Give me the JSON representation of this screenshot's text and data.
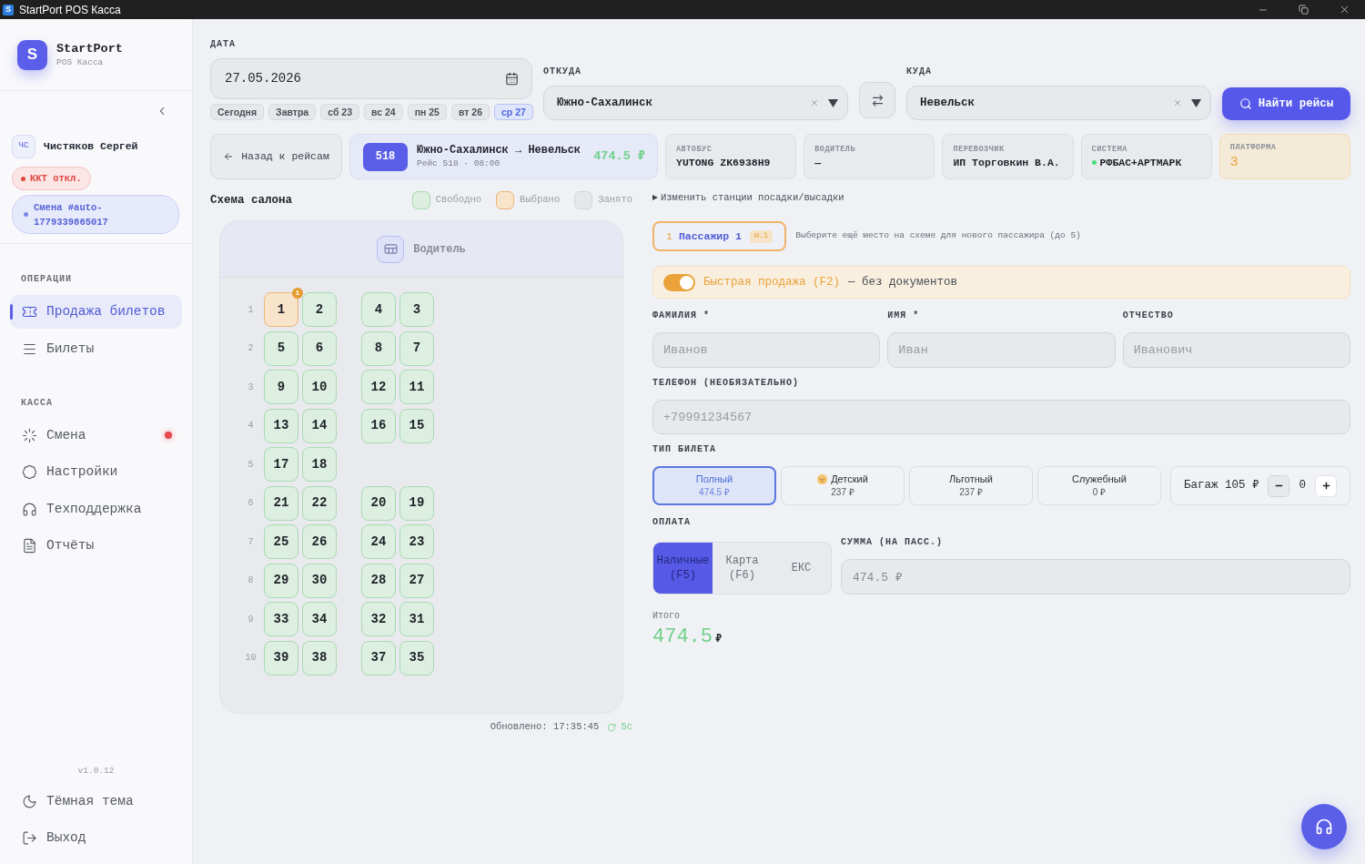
{
  "window": {
    "app_icon": "S",
    "title": "StartPort POS Касса"
  },
  "sidebar": {
    "logo_letter": "S",
    "brand_name": "StartPort",
    "brand_subtitle": "POS Касса",
    "user": {
      "initials": "ЧС",
      "name": "Чистяков Сергей"
    },
    "kkt_status": "ККТ откл.",
    "shift": "Смена #auto-1779339865017",
    "sections": [
      {
        "title": "ОПЕРАЦИИ",
        "items": [
          {
            "label": "Продажа билетов",
            "selected": true,
            "notification": false
          },
          {
            "label": "Билеты",
            "selected": false,
            "notification": false
          }
        ]
      },
      {
        "title": "КАССА",
        "items": [
          {
            "label": "Смена",
            "selected": false,
            "notification": true
          },
          {
            "label": "Настройки",
            "selected": false,
            "notification": false
          },
          {
            "label": "Техподдержка",
            "selected": false,
            "notification": false
          },
          {
            "label": "Отчёты",
            "selected": false,
            "notification": false
          }
        ]
      }
    ],
    "version": "v1.0.12",
    "footer_items": [
      "Тёмная тема",
      "Выход"
    ]
  },
  "search": {
    "date": {
      "label": "ДАТА",
      "value": "27.05.2026",
      "quick_dates": [
        {
          "label": "Сегодня",
          "selected": false
        },
        {
          "label": "Завтра",
          "selected": false
        },
        {
          "label": "сб 23",
          "selected": false
        },
        {
          "label": "вс 24",
          "selected": false
        },
        {
          "label": "пн 25",
          "selected": false
        },
        {
          "label": "вт 26",
          "selected": false
        },
        {
          "label": "ср 27",
          "selected": true
        }
      ]
    },
    "from": {
      "label": "ОТКУДА",
      "value": "Южно-Сахалинск"
    },
    "to": {
      "label": "КУДА",
      "value": "Невельск"
    },
    "search_button": "Найти рейсы"
  },
  "trip": {
    "back_button": "Назад к рейсам",
    "number": "518",
    "route": "Южно-Сахалинск → Невельск",
    "details": "Рейс 518 · 08:00",
    "price": "474.5 ₽",
    "info": [
      {
        "label": "АВТОБУС",
        "value": "YUTONG ZK6938H9",
        "kind": "plain"
      },
      {
        "label": "ВОДИТЕЛЬ",
        "value": "—",
        "kind": "plain"
      },
      {
        "label": "ПЕРЕВОЗЧИК",
        "value": "ИП Торговкин В.А.",
        "kind": "plain"
      },
      {
        "label": "СИСТЕМА",
        "value": "РФБАС+АРТМАРК",
        "kind": "status",
        "online": true
      },
      {
        "label": "ПЛАТФОРМА",
        "value": "3",
        "kind": "highlight"
      }
    ]
  },
  "seat_map": {
    "title": "Схема салона",
    "legend": [
      {
        "label": "Свободно",
        "kind": "free"
      },
      {
        "label": "Выбрано",
        "kind": "selected"
      },
      {
        "label": "Занято",
        "kind": "taken"
      }
    ],
    "driver_label": "Водитель",
    "rows": [
      {
        "number": "1",
        "left": [
          {
            "label": "1",
            "selected": true,
            "badge": "1"
          },
          {
            "label": "2",
            "selected": false
          }
        ],
        "right": [
          {
            "label": "4",
            "selected": false
          },
          {
            "label": "3",
            "selected": false
          }
        ]
      },
      {
        "number": "2",
        "left": [
          {
            "label": "5",
            "selected": false
          },
          {
            "label": "6",
            "selected": false
          }
        ],
        "right": [
          {
            "label": "8",
            "selected": false
          },
          {
            "label": "7",
            "selected": false
          }
        ]
      },
      {
        "number": "3",
        "left": [
          {
            "label": "9",
            "selected": false
          },
          {
            "label": "10",
            "selected": false
          }
        ],
        "right": [
          {
            "label": "12",
            "selected": false
          },
          {
            "label": "11",
            "selected": false
          }
        ]
      },
      {
        "number": "4",
        "left": [
          {
            "label": "13",
            "selected": false
          },
          {
            "label": "14",
            "selected": false
          }
        ],
        "right": [
          {
            "label": "16",
            "selected": false
          },
          {
            "label": "15",
            "selected": false
          }
        ]
      },
      {
        "number": "5",
        "left": [
          {
            "label": "17",
            "selected": false
          },
          {
            "label": "18",
            "selected": false
          }
        ]
      },
      {
        "number": "6",
        "left": [
          {
            "label": "21",
            "selected": false
          },
          {
            "label": "22",
            "selected": false
          }
        ],
        "right": [
          {
            "label": "20",
            "selected": false
          },
          {
            "label": "19",
            "selected": false
          }
        ]
      },
      {
        "number": "7",
        "left": [
          {
            "label": "25",
            "selected": false
          },
          {
            "label": "26",
            "selected": false
          }
        ],
        "right": [
          {
            "label": "24",
            "selected": false
          },
          {
            "label": "23",
            "selected": false
          }
        ]
      },
      {
        "number": "8",
        "left": [
          {
            "label": "29",
            "selected": false
          },
          {
            "label": "30",
            "selected": false
          }
        ],
        "right": [
          {
            "label": "28",
            "selected": false
          },
          {
            "label": "27",
            "selected": false
          }
        ]
      },
      {
        "number": "9",
        "left": [
          {
            "label": "33",
            "selected": false
          },
          {
            "label": "34",
            "selected": false
          }
        ],
        "right": [
          {
            "label": "32",
            "selected": false
          },
          {
            "label": "31",
            "selected": false
          }
        ]
      },
      {
        "number": "10",
        "left": [
          {
            "label": "39",
            "selected": false
          },
          {
            "label": "38",
            "selected": false
          }
        ],
        "right": [
          {
            "label": "37",
            "selected": false
          },
          {
            "label": "35",
            "selected": false
          }
        ]
      }
    ],
    "updated": "Обновлено: 17:35:45",
    "refresh_interval": "5с"
  },
  "sale": {
    "stations_toggle": {
      "label": "Изменить станции посадки/высадки",
      "expanded": false
    },
    "passengers": [
      {
        "index": "1",
        "name": "Пассажир 1",
        "seat": "м.1",
        "selected": true
      }
    ],
    "passenger_hint": "Выберите ещё место на схеме для нового пассажира (до 5)",
    "quick_sale": {
      "on": true,
      "label": "Быстрая продажа (F2)",
      "note": "— без документов"
    },
    "fields": [
      {
        "label": "ФАМИЛИЯ *",
        "placeholder": "Иванов"
      },
      {
        "label": "ИМЯ *",
        "placeholder": "Иван"
      },
      {
        "label": "ОТЧЕСТВО",
        "placeholder": "Иванович"
      }
    ],
    "phone": {
      "label": "ТЕЛЕФОН (НЕОБЯЗАТЕЛЬНО)",
      "placeholder": "+79991234567"
    },
    "ticket_type": {
      "label": "ТИП БИЛЕТА",
      "options": [
        {
          "name": "Полный",
          "price": "474.5 ₽",
          "kind": "full",
          "selected": true
        },
        {
          "name": "Детский",
          "price": "237 ₽",
          "kind": "child",
          "selected": false
        },
        {
          "name": "Льготный",
          "price": "237 ₽",
          "kind": "reduced",
          "selected": false
        },
        {
          "name": "Служебный",
          "price": "0 ₽",
          "kind": "service",
          "selected": false
        }
      ]
    },
    "baggage": {
      "label": "Багаж 105 ₽",
      "count": "0"
    },
    "payment": {
      "label": "ОПЛАТА",
      "methods": [
        {
          "label": "Наличные (F5)",
          "selected": true
        },
        {
          "label": "Карта (F6)",
          "selected": false
        },
        {
          "label": "ЕКС",
          "selected": false
        }
      ]
    },
    "amount": {
      "label": "СУММА (НА ПАСС.)",
      "value": "474.5 ₽",
      "disabled": true
    },
    "total": {
      "label": "Итого",
      "amount": "474.5",
      "currency": "₽"
    }
  }
}
